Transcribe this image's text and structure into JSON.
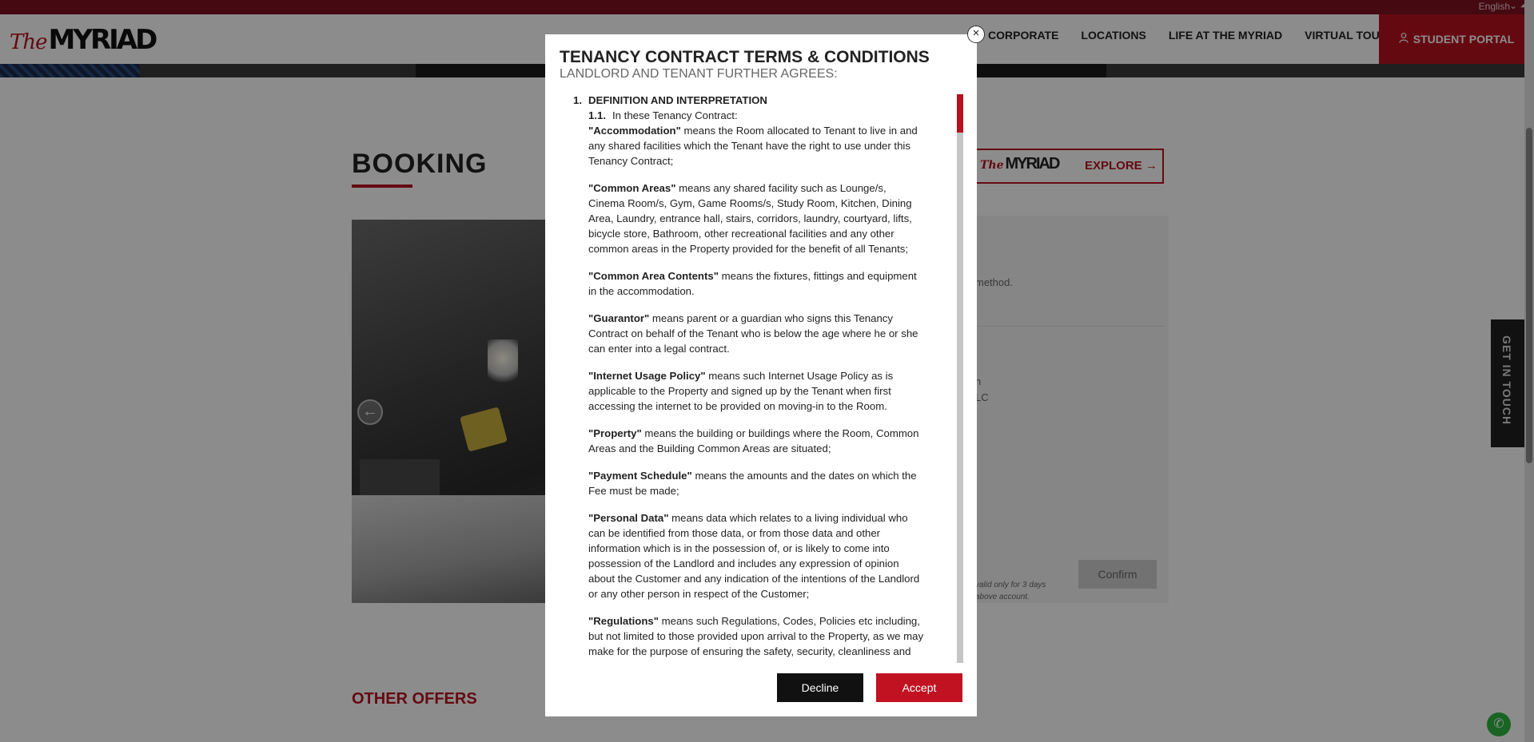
{
  "top_bar": {
    "language": "English"
  },
  "header": {
    "logo_the": "The",
    "logo_main": "MYRIAD",
    "nav": [
      "CORPORATE",
      "LOCATIONS",
      "LIFE AT THE MYRIAD",
      "VIRTUAL TOURS"
    ],
    "portal_label": "STUDENT PORTAL"
  },
  "main": {
    "title": "BOOKING",
    "right_card_logo": "MYRIAD",
    "right_card_logo_sub": "The",
    "explore_label": "EXPLORE",
    "panel_text1": "method.",
    "panel_text2": "n",
    "panel_text3": "LC",
    "note1": "valid only for 3 days",
    "note2": "above account.",
    "confirm_label": "Confirm",
    "side_tab": "GET IN TOUCH",
    "other_offers": "OTHER OFFERS"
  },
  "modal": {
    "title": "TENANCY CONTRACT TERMS & CONDITIONS",
    "subtitle": "LANDLORD AND TENANT FURTHER AGREES:",
    "section_number": "1.",
    "section_title": "DEFINITION AND INTERPRETATION",
    "clause_number": "1.1.",
    "clause_text": "In these Tenancy Contract:",
    "definitions": [
      {
        "term": "\"Accommodation\"",
        "text": " means the Room allocated to Tenant to live in and any shared facilities which the Tenant have the right to use under this Tenancy Contract;"
      },
      {
        "term": "\"Common Areas\"",
        "text": " means any shared facility such as Lounge/s, Cinema Room/s, Gym, Game Rooms/s, Study Room, Kitchen, Dining Area, Laundry, entrance hall, stairs, corridors, laundry, courtyard, lifts, bicycle store, Bathroom, other recreational facilities and any other common areas in the Property provided for the benefit of all Tenants;"
      },
      {
        "term": "\"Common Area Contents\"",
        "text": " means the fixtures, fittings and equipment in the accommodation."
      },
      {
        "term": "\"Guarantor\"",
        "text": " means parent or a guardian who signs this Tenancy Contract on behalf of the Tenant who is below the age where he or she can enter into a legal contract."
      },
      {
        "term": "\"Internet Usage Policy\"",
        "text": " means such Internet Usage Policy as is applicable to the Property and signed up by the Tenant when first accessing the internet to be provided on moving-in to the Room."
      },
      {
        "term": "\"Property\"",
        "text": " means the building or buildings where the Room, Common Areas and the Building Common Areas are situated;"
      },
      {
        "term": "\"Payment Schedule\"",
        "text": " means the amounts and the dates on which the Fee must be made;"
      },
      {
        "term": "\"Personal Data\"",
        "text": " means data which relates to a living individual who can be identified from those data, or from those data and other information which is in the possession of, or is likely to come into possession of the Landlord and includes any expression of opinion about the Customer and any indication of the intentions of the Landlord or any other person in respect of the Customer;"
      },
      {
        "term": "\"Regulations\"",
        "text": " means such Regulations, Codes, Policies etc including, but not limited to those provided upon arrival to the Property, as we may make for the purpose of ensuring the safety, security, cleanliness and good management of the Property, any part of it, or the comfort or convenience"
      }
    ],
    "decline_label": "Decline",
    "accept_label": "Accept"
  }
}
